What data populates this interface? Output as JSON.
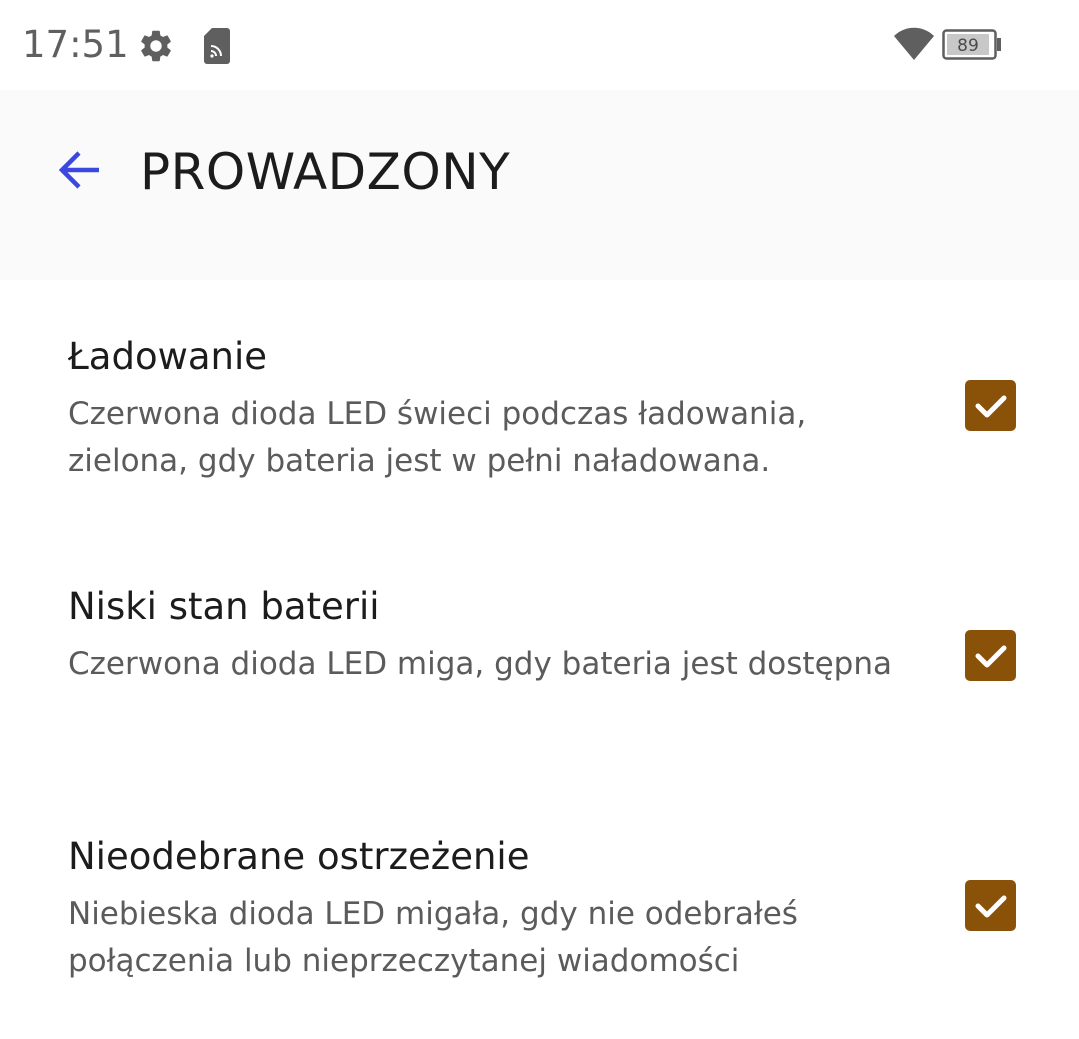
{
  "status_bar": {
    "time": "17:51",
    "icons": [
      "settings-gear-icon",
      "sd-card-icon",
      "wifi-icon",
      "battery-icon"
    ],
    "battery_level": "89"
  },
  "toolbar": {
    "back_icon": "arrow-left-icon",
    "title": "PROWADZONY",
    "accent_color": "#3b48e0"
  },
  "preferences": [
    {
      "title": "Ładowanie",
      "summary": "Czerwona dioda LED świeci podczas ładowania, zielona, gdy bateria jest w pełni naładowana.",
      "checked": true
    },
    {
      "title": "Niski stan baterii",
      "summary": "Czerwona dioda LED miga, gdy bateria jest dostępna",
      "checked": true
    },
    {
      "title": "Nieodebrane ostrzeżenie",
      "summary": "Niebieska dioda LED migała, gdy nie odebrałeś połączenia lub nieprzeczytanej wiadomości",
      "checked": true
    }
  ],
  "colors": {
    "checkbox_fill": "#8a5209",
    "checkmark": "#ffffff",
    "toolbar_background": "#fafafa"
  }
}
